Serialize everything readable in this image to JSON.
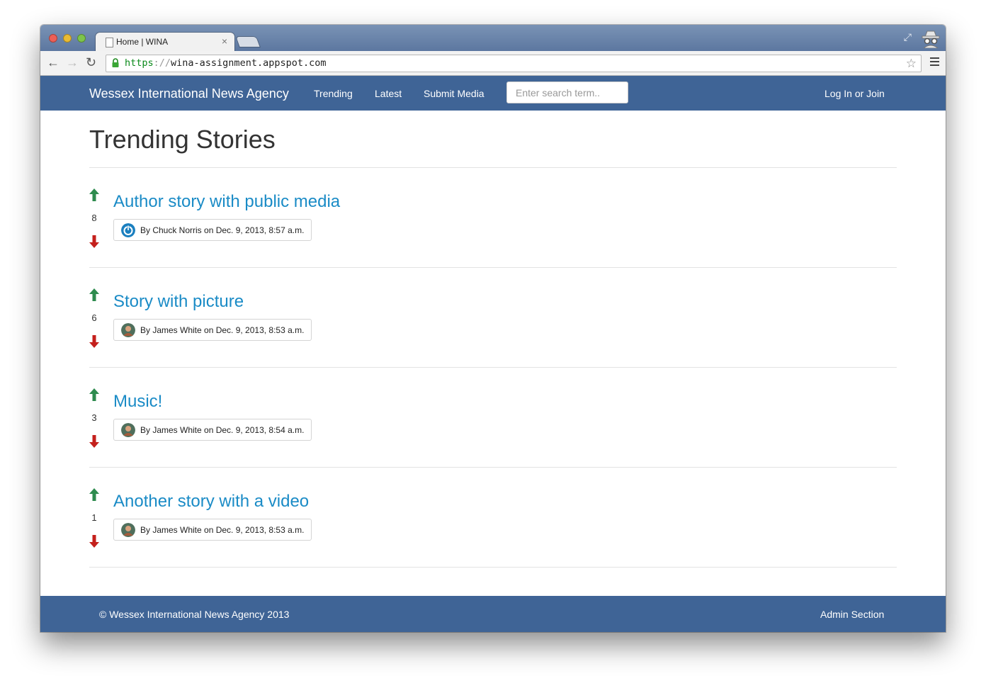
{
  "browser": {
    "tab_title": "Home | WINA",
    "tab_close": "×",
    "url_scheme": "https",
    "url_separator": "://",
    "url_host": "wina-assignment.appspot.com",
    "icons": [
      "back-icon",
      "forward-icon",
      "reload-icon",
      "lock-icon",
      "star-icon",
      "menu-icon",
      "incognito-icon",
      "fullscreen-icon"
    ]
  },
  "navbar": {
    "brand": "Wessex International News Agency",
    "links": [
      "Trending",
      "Latest",
      "Submit Media"
    ],
    "search_placeholder": "Enter search term..",
    "login": "Log In or Join"
  },
  "page": {
    "title": "Trending Stories"
  },
  "stories": [
    {
      "title": "Author story with public media",
      "votes": "8",
      "byline": "By Chuck Norris on Dec. 9, 2013, 8:57 a.m.",
      "avatar": "power-icon"
    },
    {
      "title": "Story with picture",
      "votes": "6",
      "byline": "By James White on Dec. 9, 2013, 8:53 a.m.",
      "avatar": "user-photo"
    },
    {
      "title": "Music!",
      "votes": "3",
      "byline": "By James White on Dec. 9, 2013, 8:54 a.m.",
      "avatar": "user-photo"
    },
    {
      "title": "Another story with a video",
      "votes": "1",
      "byline": "By James White on Dec. 9, 2013, 8:53 a.m.",
      "avatar": "user-photo"
    }
  ],
  "colors": {
    "navbar": "#3f6496",
    "link": "#1a8bc6",
    "upvote": "#2e8b4e",
    "downvote": "#c4201c"
  },
  "footer": {
    "copyright": "© Wessex International News Agency 2013",
    "admin": "Admin Section"
  }
}
